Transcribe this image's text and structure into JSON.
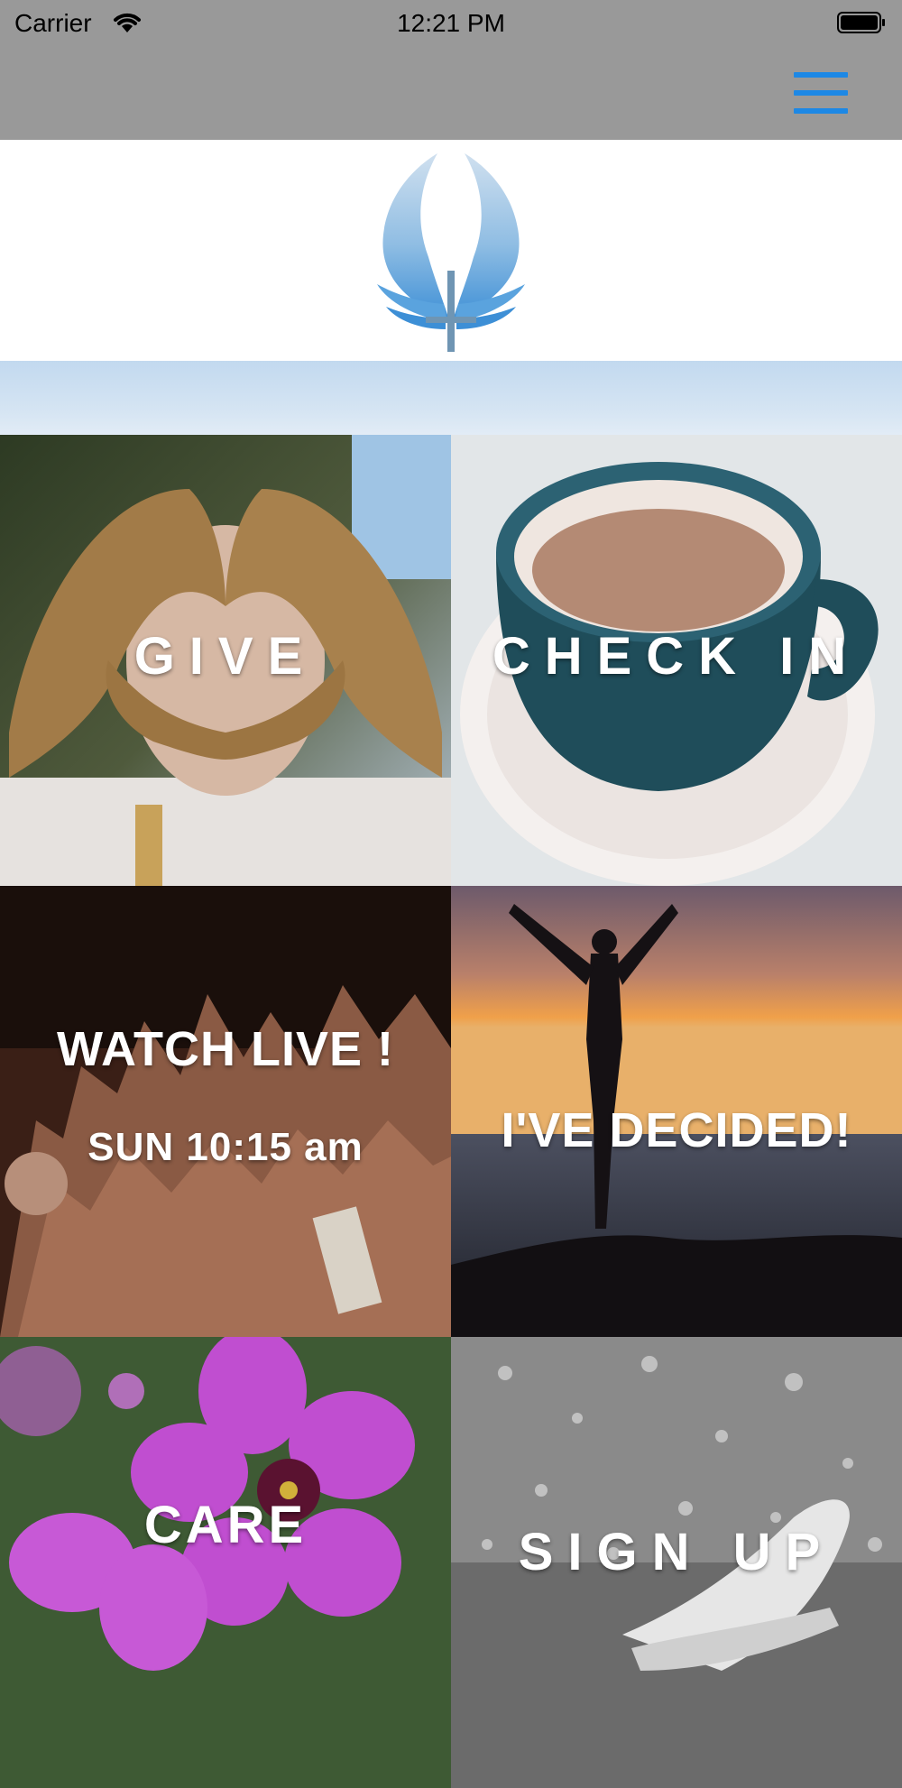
{
  "status_bar": {
    "carrier": "Carrier",
    "time": "12:21 PM"
  },
  "nav": {
    "menu_icon": "hamburger-menu-icon",
    "accent_color": "#1d88e5"
  },
  "tiles": [
    {
      "label": "GIVE"
    },
    {
      "label": "CHECK IN"
    },
    {
      "label": "WATCH LIVE !",
      "sublabel": "SUN 10:15 am"
    },
    {
      "label": "I'VE DECIDED!"
    },
    {
      "label": "CARE"
    },
    {
      "label": "SIGN UP"
    }
  ]
}
